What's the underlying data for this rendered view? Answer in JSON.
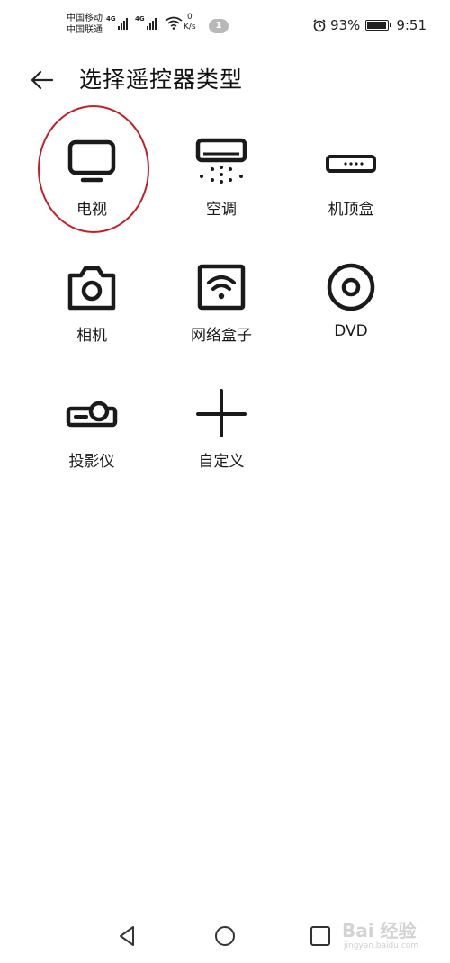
{
  "status_bar": {
    "carrier_1": "中国移动",
    "carrier_2": "中国联通",
    "net_type_1": "4G",
    "net_type_2": "4G",
    "speed_value": "0",
    "speed_unit": "K/s",
    "notification_count": "1",
    "battery_text": "93%",
    "battery_level": 0.93,
    "time": "9:51",
    "icons": [
      "signal-icon",
      "wifi-icon",
      "alarm-icon",
      "battery-icon"
    ]
  },
  "header": {
    "back_icon": "arrow-left-icon",
    "title": "选择遥控器类型"
  },
  "devices": [
    {
      "label": "电视",
      "icon": "tv-icon"
    },
    {
      "label": "空调",
      "icon": "air-conditioner-icon"
    },
    {
      "label": "机顶盒",
      "icon": "set-top-box-icon"
    },
    {
      "label": "相机",
      "icon": "camera-icon"
    },
    {
      "label": "网络盒子",
      "icon": "network-box-icon"
    },
    {
      "label": "DVD",
      "icon": "dvd-icon"
    },
    {
      "label": "投影仪",
      "icon": "projector-icon"
    },
    {
      "label": "自定义",
      "icon": "plus-icon"
    }
  ],
  "annotation": {
    "highlight_color": "#c0202a"
  },
  "nav_bar": {
    "icons": [
      "back-triangle-icon",
      "home-circle-icon",
      "recents-square-icon"
    ]
  },
  "watermark": {
    "main": "Bai 经验",
    "sub": "jingyan.baidu.com"
  }
}
